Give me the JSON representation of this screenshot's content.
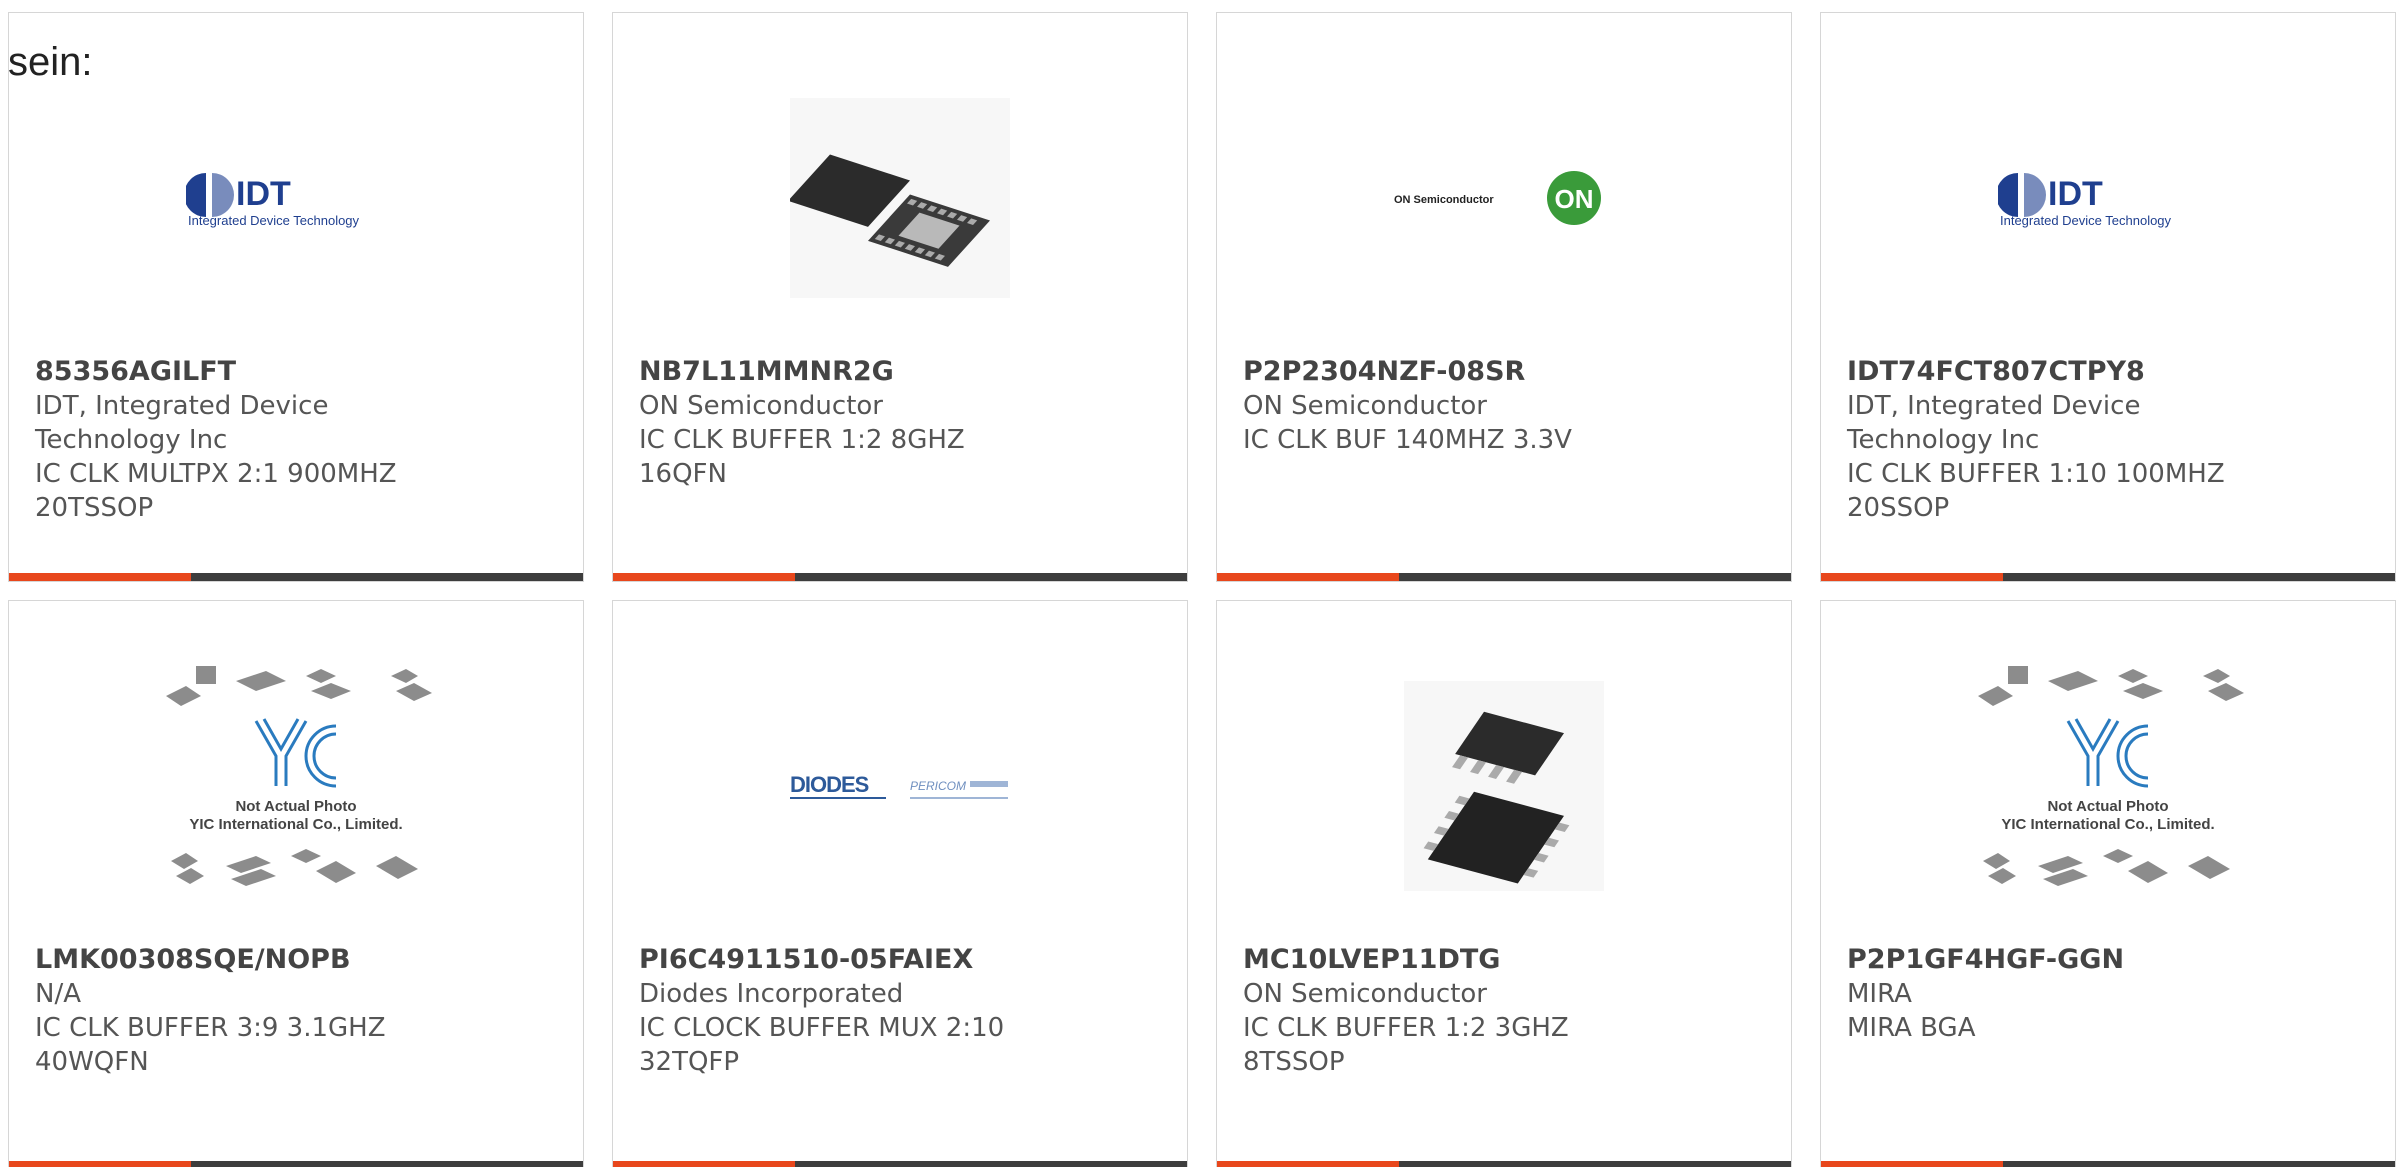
{
  "intro_text": "sein:",
  "products": [
    {
      "part_number": "85356AGILFT",
      "manufacturer": "IDT, Integrated Device Technology Inc",
      "description": "IC CLK MULTPX 2:1 900MHZ 20TSSOP",
      "image": "idt-logo"
    },
    {
      "part_number": "NB7L11MMNR2G",
      "manufacturer": "ON Semiconductor",
      "description": "IC CLK BUFFER 1:2 8GHZ 16QFN",
      "image": "qfn-chip-photo"
    },
    {
      "part_number": "P2P2304NZF-08SR",
      "manufacturer": "ON Semiconductor",
      "description": "IC CLK BUF 140MHZ 3.3V",
      "image": "on-semi-logo"
    },
    {
      "part_number": "IDT74FCT807CTPY8",
      "manufacturer": "IDT, Integrated Device Technology Inc",
      "description": "IC CLK BUFFER 1:10 100MHZ 20SSOP",
      "image": "idt-logo"
    },
    {
      "part_number": "LMK00308SQE/NOPB",
      "manufacturer": "N/A",
      "description": "IC CLK BUFFER 3:9 3.1GHZ 40WQFN",
      "image": "yic-placeholder"
    },
    {
      "part_number": "PI6C4911510-05FAIEX",
      "manufacturer": "Diodes Incorporated",
      "description": "IC CLOCK BUFFER MUX 2:10 32TQFP",
      "image": "diodes-pericom-logo"
    },
    {
      "part_number": "MC10LVEP11DTG",
      "manufacturer": "ON Semiconductor",
      "description": "IC CLK BUFFER 1:2 3GHZ 8TSSOP",
      "image": "tssop-chip-photo"
    },
    {
      "part_number": "P2P1GF4HGF-GGN",
      "manufacturer": "MIRA",
      "description": "MIRA BGA",
      "image": "yic-placeholder"
    }
  ],
  "logos": {
    "idt_brand": "IDT",
    "idt_full": "Integrated Device Technology",
    "on_brand": "ON Semiconductor",
    "on_mark": "ON",
    "diodes_brand": "DIODES",
    "pericom_brand": "PERICOM",
    "yic_mark": "YIC",
    "yic_line1": "Not Actual Photo",
    "yic_line2": "YIC International Co., Limited."
  },
  "colors": {
    "accent": "#e8471c",
    "bar": "#3d3d3d",
    "idt_blue": "#1f3f8f",
    "on_green": "#3a9b3a",
    "diodes_blue": "#2d5a9a",
    "yic_blue": "#2a7bbf"
  }
}
